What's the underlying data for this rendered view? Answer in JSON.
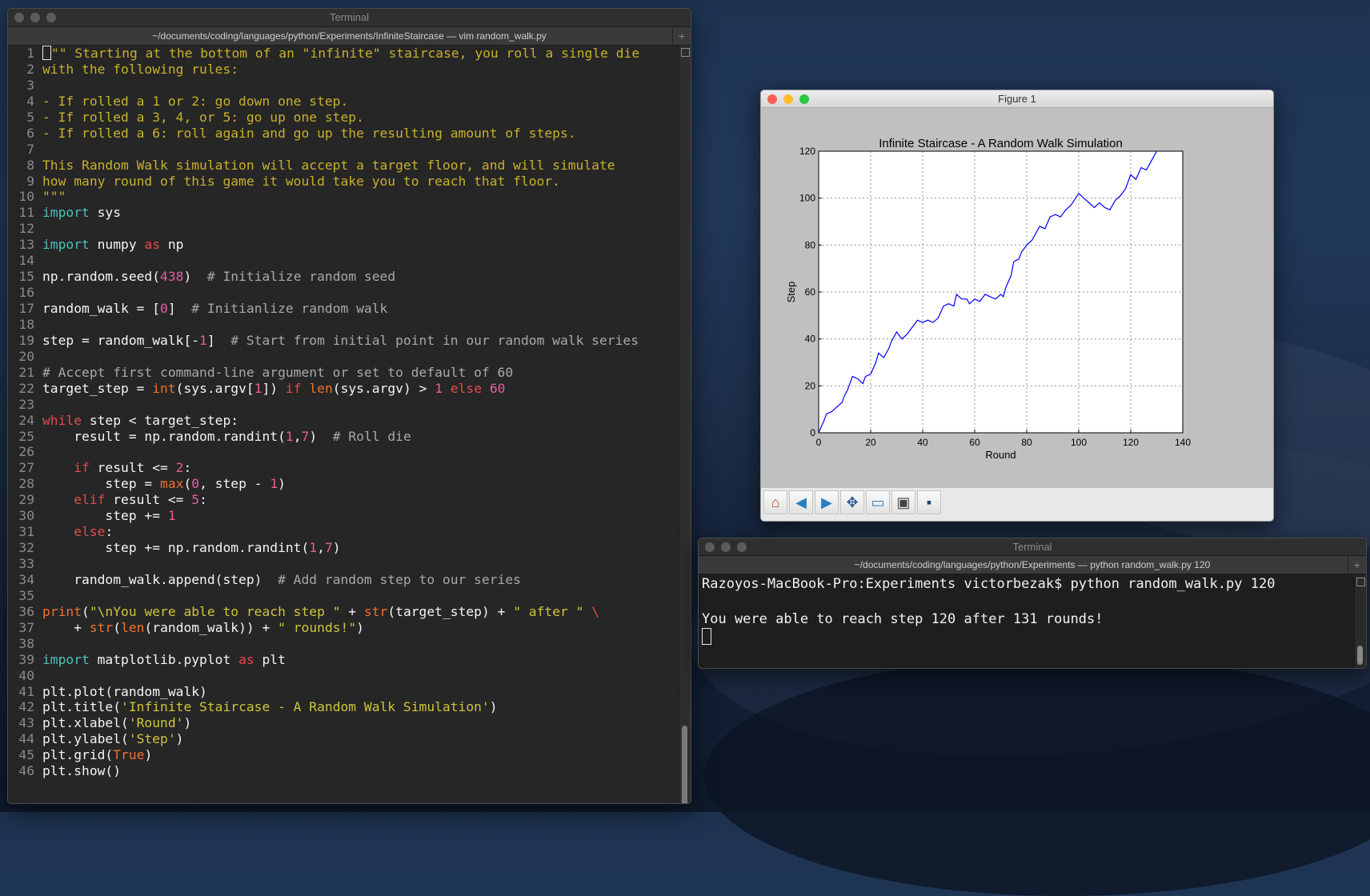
{
  "vim_window": {
    "title": "Terminal",
    "tab": "~/documents/coding/languages/python/Experiments/InfiniteStaircase — vim random_walk.py",
    "lines": [
      {
        "n": "1",
        "tokens": [
          [
            "doc",
            "\"\" Starting at the bottom of an \"infinite\" staircase, you roll a single die"
          ]
        ],
        "cursor": true
      },
      {
        "n": "2",
        "tokens": [
          [
            "doc",
            "with the following rules:"
          ]
        ]
      },
      {
        "n": "3",
        "tokens": []
      },
      {
        "n": "4",
        "tokens": [
          [
            "doc",
            "- If rolled a 1 or 2: go down one step."
          ]
        ]
      },
      {
        "n": "5",
        "tokens": [
          [
            "doc",
            "- If rolled a 3, 4, or 5: go up one step."
          ]
        ]
      },
      {
        "n": "6",
        "tokens": [
          [
            "doc",
            "- If rolled a 6: roll again and go up the resulting amount of steps."
          ]
        ]
      },
      {
        "n": "7",
        "tokens": []
      },
      {
        "n": "8",
        "tokens": [
          [
            "doc",
            "This Random Walk simulation will accept a target floor, and will simulate"
          ]
        ]
      },
      {
        "n": "9",
        "tokens": [
          [
            "doc",
            "how many round of this game it would take you to reach that floor."
          ]
        ]
      },
      {
        "n": "10",
        "tokens": [
          [
            "doc",
            "\"\"\""
          ]
        ]
      },
      {
        "n": "11",
        "tokens": [
          [
            "kw2",
            "import"
          ],
          [
            "plain",
            " sys"
          ]
        ]
      },
      {
        "n": "12",
        "tokens": []
      },
      {
        "n": "13",
        "tokens": [
          [
            "kw2",
            "import"
          ],
          [
            "plain",
            " numpy "
          ],
          [
            "kw",
            "as"
          ],
          [
            "plain",
            " np"
          ]
        ]
      },
      {
        "n": "14",
        "tokens": []
      },
      {
        "n": "15",
        "tokens": [
          [
            "plain",
            "np.random.seed("
          ],
          [
            "num",
            "438"
          ],
          [
            "plain",
            ")  "
          ],
          [
            "com",
            "# Initialize random seed"
          ]
        ]
      },
      {
        "n": "16",
        "tokens": []
      },
      {
        "n": "17",
        "tokens": [
          [
            "plain",
            "random_walk = ["
          ],
          [
            "num",
            "0"
          ],
          [
            "plain",
            "]  "
          ],
          [
            "com",
            "# Initianlize random walk"
          ]
        ]
      },
      {
        "n": "18",
        "tokens": []
      },
      {
        "n": "19",
        "tokens": [
          [
            "plain",
            "step = random_walk[-"
          ],
          [
            "num",
            "1"
          ],
          [
            "plain",
            "]  "
          ],
          [
            "com",
            "# Start from initial point in our random walk series"
          ]
        ]
      },
      {
        "n": "20",
        "tokens": []
      },
      {
        "n": "21",
        "tokens": [
          [
            "com",
            "# Accept first command-line argument or set to default of 60"
          ]
        ]
      },
      {
        "n": "22",
        "tokens": [
          [
            "plain",
            "target_step = "
          ],
          [
            "fn",
            "int"
          ],
          [
            "plain",
            "(sys.argv["
          ],
          [
            "num",
            "1"
          ],
          [
            "plain",
            "]) "
          ],
          [
            "kw",
            "if"
          ],
          [
            "plain",
            " "
          ],
          [
            "fn",
            "len"
          ],
          [
            "plain",
            "(sys.argv) > "
          ],
          [
            "num",
            "1"
          ],
          [
            "plain",
            " "
          ],
          [
            "kw",
            "else"
          ],
          [
            "plain",
            " "
          ],
          [
            "num",
            "60"
          ]
        ]
      },
      {
        "n": "23",
        "tokens": []
      },
      {
        "n": "24",
        "tokens": [
          [
            "kw",
            "while"
          ],
          [
            "plain",
            " step < target_step:"
          ]
        ]
      },
      {
        "n": "25",
        "tokens": [
          [
            "plain",
            "    result = np.random.randint("
          ],
          [
            "num",
            "1"
          ],
          [
            "plain",
            ","
          ],
          [
            "num",
            "7"
          ],
          [
            "plain",
            ")  "
          ],
          [
            "com",
            "# Roll die"
          ]
        ]
      },
      {
        "n": "26",
        "tokens": []
      },
      {
        "n": "27",
        "tokens": [
          [
            "plain",
            "    "
          ],
          [
            "kw",
            "if"
          ],
          [
            "plain",
            " result <= "
          ],
          [
            "num",
            "2"
          ],
          [
            "plain",
            ":"
          ]
        ]
      },
      {
        "n": "28",
        "tokens": [
          [
            "plain",
            "        step = "
          ],
          [
            "fn",
            "max"
          ],
          [
            "plain",
            "("
          ],
          [
            "num",
            "0"
          ],
          [
            "plain",
            ", step - "
          ],
          [
            "num",
            "1"
          ],
          [
            "plain",
            ")"
          ]
        ]
      },
      {
        "n": "29",
        "tokens": [
          [
            "plain",
            "    "
          ],
          [
            "kw",
            "elif"
          ],
          [
            "plain",
            " result <= "
          ],
          [
            "num",
            "5"
          ],
          [
            "plain",
            ":"
          ]
        ]
      },
      {
        "n": "30",
        "tokens": [
          [
            "plain",
            "        step += "
          ],
          [
            "num",
            "1"
          ]
        ]
      },
      {
        "n": "31",
        "tokens": [
          [
            "plain",
            "    "
          ],
          [
            "kw",
            "else"
          ],
          [
            "plain",
            ":"
          ]
        ]
      },
      {
        "n": "32",
        "tokens": [
          [
            "plain",
            "        step += np.random.randint("
          ],
          [
            "num",
            "1"
          ],
          [
            "plain",
            ","
          ],
          [
            "num",
            "7"
          ],
          [
            "plain",
            ")"
          ]
        ]
      },
      {
        "n": "33",
        "tokens": []
      },
      {
        "n": "34",
        "tokens": [
          [
            "plain",
            "    random_walk.append(step)  "
          ],
          [
            "com",
            "# Add random step to our series"
          ]
        ]
      },
      {
        "n": "35",
        "tokens": []
      },
      {
        "n": "36",
        "tokens": [
          [
            "fn",
            "print"
          ],
          [
            "plain",
            "("
          ],
          [
            "str",
            "\"\\nYou were able to reach step \""
          ],
          [
            "plain",
            " + "
          ],
          [
            "fn",
            "str"
          ],
          [
            "plain",
            "(target_step) + "
          ],
          [
            "str",
            "\" after \""
          ],
          [
            "plain",
            " "
          ],
          [
            "kw",
            "\\"
          ]
        ]
      },
      {
        "n": "37",
        "tokens": [
          [
            "plain",
            "    + "
          ],
          [
            "fn",
            "str"
          ],
          [
            "plain",
            "("
          ],
          [
            "fn",
            "len"
          ],
          [
            "plain",
            "(random_walk)) + "
          ],
          [
            "str",
            "\" rounds!\""
          ],
          [
            "plain",
            ")"
          ]
        ]
      },
      {
        "n": "38",
        "tokens": []
      },
      {
        "n": "39",
        "tokens": [
          [
            "kw2",
            "import"
          ],
          [
            "plain",
            " matplotlib.pyplot "
          ],
          [
            "kw",
            "as"
          ],
          [
            "plain",
            " plt"
          ]
        ]
      },
      {
        "n": "40",
        "tokens": []
      },
      {
        "n": "41",
        "tokens": [
          [
            "plain",
            "plt.plot(random_walk)"
          ]
        ]
      },
      {
        "n": "42",
        "tokens": [
          [
            "plain",
            "plt.title("
          ],
          [
            "str",
            "'Infinite Staircase - A Random Walk Simulation'"
          ],
          [
            "plain",
            ")"
          ]
        ]
      },
      {
        "n": "43",
        "tokens": [
          [
            "plain",
            "plt.xlabel("
          ],
          [
            "str",
            "'Round'"
          ],
          [
            "plain",
            ")"
          ]
        ]
      },
      {
        "n": "44",
        "tokens": [
          [
            "plain",
            "plt.ylabel("
          ],
          [
            "str",
            "'Step'"
          ],
          [
            "plain",
            ")"
          ]
        ]
      },
      {
        "n": "45",
        "tokens": [
          [
            "plain",
            "plt.grid("
          ],
          [
            "bool",
            "True"
          ],
          [
            "plain",
            ")"
          ]
        ]
      },
      {
        "n": "46",
        "tokens": [
          [
            "plain",
            "plt.show()"
          ]
        ]
      }
    ]
  },
  "figure_window": {
    "title": "Figure 1",
    "toolbar": [
      {
        "name": "home-icon",
        "glyph": "⌂",
        "color": "#b5472b"
      },
      {
        "name": "back-arrow-icon",
        "glyph": "◀",
        "color": "#2a7fbf"
      },
      {
        "name": "forward-arrow-icon",
        "glyph": "▶",
        "color": "#2a7fbf"
      },
      {
        "name": "pan-icon",
        "glyph": "✥",
        "color": "#2d5e9a"
      },
      {
        "name": "zoom-rect-icon",
        "glyph": "▭",
        "color": "#3c7fb8"
      },
      {
        "name": "configure-subplots-icon",
        "glyph": "▣",
        "color": "#444444"
      },
      {
        "name": "save-icon",
        "glyph": "▪",
        "color": "#1f3e63"
      }
    ]
  },
  "chart_data": {
    "type": "line",
    "title": "Infinite Staircase - A Random Walk Simulation",
    "xlabel": "Round",
    "ylabel": "Step",
    "xlim": [
      0,
      140
    ],
    "ylim": [
      0,
      120
    ],
    "xticks": [
      0,
      20,
      40,
      60,
      80,
      100,
      120,
      140
    ],
    "yticks": [
      0,
      20,
      40,
      60,
      80,
      100,
      120
    ],
    "grid": true,
    "color": "#0000ff",
    "series": [
      {
        "points": [
          [
            0,
            0
          ],
          [
            2,
            5
          ],
          [
            3,
            8
          ],
          [
            5,
            9
          ],
          [
            7,
            11
          ],
          [
            9,
            13
          ],
          [
            10,
            16
          ],
          [
            11,
            18
          ],
          [
            12,
            21
          ],
          [
            13,
            24
          ],
          [
            15,
            23
          ],
          [
            17,
            21
          ],
          [
            18,
            24
          ],
          [
            20,
            25
          ],
          [
            22,
            30
          ],
          [
            23,
            34
          ],
          [
            25,
            32
          ],
          [
            27,
            36
          ],
          [
            28,
            39
          ],
          [
            30,
            43
          ],
          [
            32,
            40
          ],
          [
            34,
            42
          ],
          [
            36,
            45
          ],
          [
            38,
            48
          ],
          [
            40,
            47
          ],
          [
            42,
            48
          ],
          [
            44,
            47
          ],
          [
            46,
            49
          ],
          [
            48,
            54
          ],
          [
            50,
            55
          ],
          [
            52,
            54
          ],
          [
            53,
            59
          ],
          [
            55,
            57
          ],
          [
            57,
            57
          ],
          [
            58,
            55
          ],
          [
            60,
            57
          ],
          [
            62,
            56
          ],
          [
            64,
            59
          ],
          [
            66,
            58
          ],
          [
            68,
            57
          ],
          [
            70,
            59
          ],
          [
            71,
            58
          ],
          [
            72,
            62
          ],
          [
            74,
            67
          ],
          [
            75,
            73
          ],
          [
            77,
            74
          ],
          [
            78,
            77
          ],
          [
            80,
            80
          ],
          [
            82,
            82
          ],
          [
            84,
            86
          ],
          [
            85,
            88
          ],
          [
            87,
            87
          ],
          [
            89,
            92
          ],
          [
            91,
            93
          ],
          [
            93,
            92
          ],
          [
            95,
            95
          ],
          [
            97,
            97
          ],
          [
            100,
            102
          ],
          [
            102,
            100
          ],
          [
            104,
            98
          ],
          [
            106,
            96
          ],
          [
            108,
            98
          ],
          [
            110,
            96
          ],
          [
            112,
            95
          ],
          [
            114,
            99
          ],
          [
            116,
            101
          ],
          [
            118,
            104
          ],
          [
            120,
            110
          ],
          [
            122,
            108
          ],
          [
            124,
            113
          ],
          [
            126,
            112
          ],
          [
            128,
            116
          ],
          [
            130,
            120
          ]
        ]
      }
    ]
  },
  "terminal_window": {
    "title": "Terminal",
    "tab": "~/documents/coding/languages/python/Experiments — python random_walk.py 120",
    "prompt_line": "Razoyos-MacBook-Pro:Experiments victorbezak$ python random_walk.py 120",
    "output_line": "You were able to reach step 120 after 131 rounds!"
  }
}
